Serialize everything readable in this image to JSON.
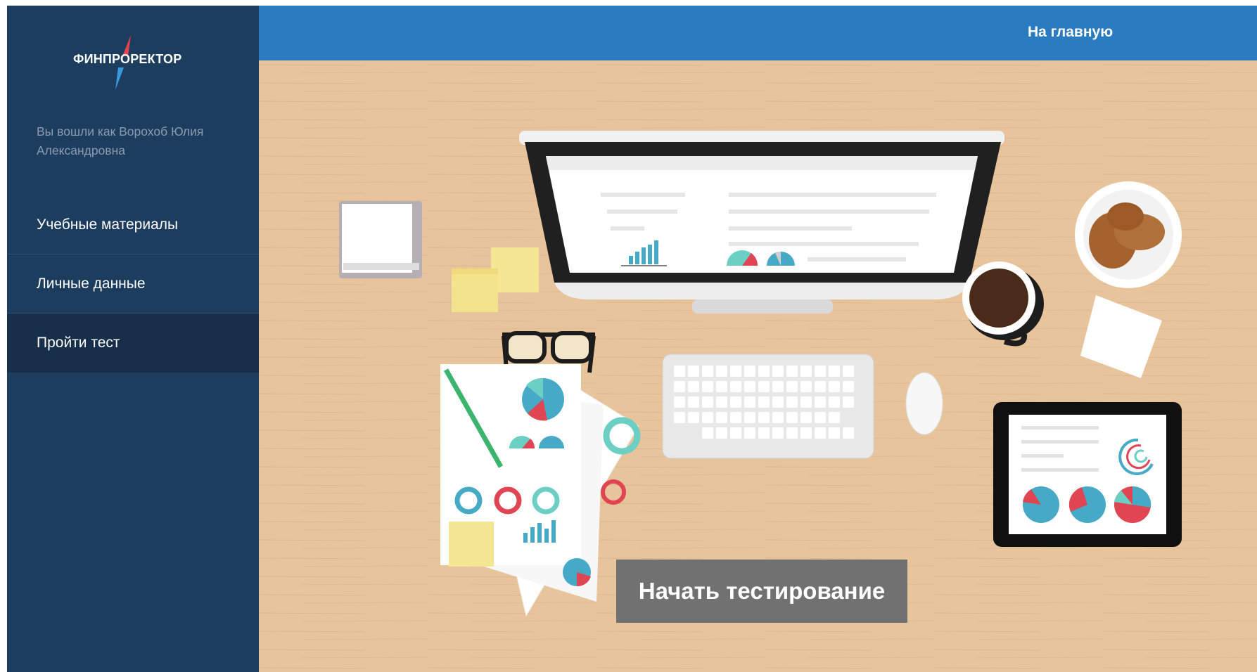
{
  "app": {
    "logo_text": "ФИНПРОРЕКТОР"
  },
  "sidebar": {
    "user_text": "Вы вошли как Ворохоб Юлия Александровна",
    "items": [
      {
        "label": "Учебные материалы",
        "active": false
      },
      {
        "label": "Личные данные",
        "active": false
      },
      {
        "label": "Пройти тест",
        "active": true
      }
    ]
  },
  "header": {
    "home_label": "На главную"
  },
  "main": {
    "start_button_label": "Начать тестирование"
  },
  "colors": {
    "sidebar_bg": "#1d3d5f",
    "header_bg": "#2a7bbf",
    "desk_bg": "#e8c49c",
    "button_bg": "#717171",
    "accent_teal": "#46a9c6",
    "accent_red": "#e04553",
    "accent_mint": "#6ccfc4"
  },
  "icons": {
    "logo_arrow": "red-blue-arrow-icon"
  }
}
